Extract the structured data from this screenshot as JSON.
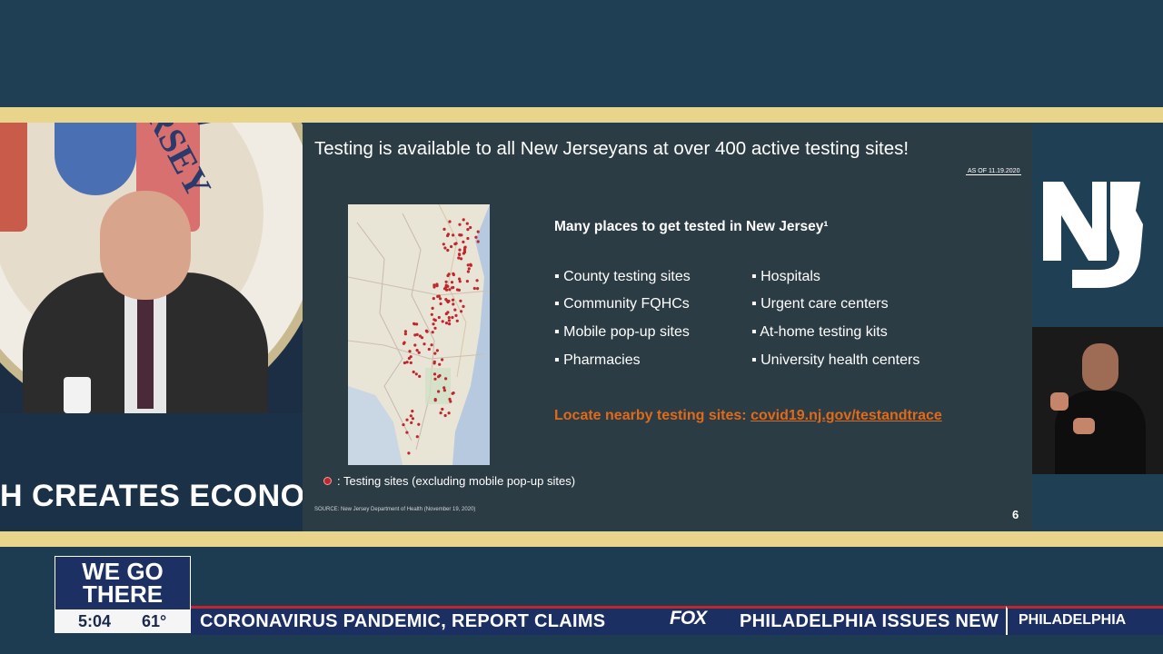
{
  "podium": {
    "banner_text": "H CREATES ECONOM"
  },
  "seal": {
    "ring_text": "NEW JERSEY"
  },
  "slide": {
    "title": "Testing is available to all New Jerseyans at over 400 active testing sites!",
    "as_of": "AS OF 11.19.2020",
    "subhead": "Many places to get tested in New Jersey¹",
    "bullets_left": [
      "County testing sites",
      "Community FQHCs",
      "Mobile pop-up sites",
      "Pharmacies"
    ],
    "bullets_right": [
      "Hospitals",
      "Urgent care centers",
      "At-home testing kits",
      "University health centers"
    ],
    "locate_prefix": "Locate nearby testing sites: ",
    "locate_link": "covid19.nj.gov/testandtrace",
    "legend": ": Testing sites (excluding mobile pop-up sites)",
    "source": "SOURCE: New Jersey Department of Health (November 19, 2020)",
    "page_number": "6",
    "bullet_marker": "▪"
  },
  "branding": {
    "we_go_there": "WE GO THERE",
    "time": "5:04",
    "temperature": "61°",
    "ticker": [
      "CORONAVIRUS PANDEMIC, REPORT CLAIMS",
      "PHILADELPHIA ISSUES NEW"
    ],
    "network": "FOX",
    "station": "PHILADELPHIA"
  },
  "colors": {
    "accent_orange": "#e06a1a",
    "gold_bar": "#e8d48a",
    "navy": "#1b2f63",
    "site_dot": "#c0272d"
  },
  "icons": [
    "nj-logo-icon",
    "testing-site-dot-icon",
    "map-image"
  ]
}
